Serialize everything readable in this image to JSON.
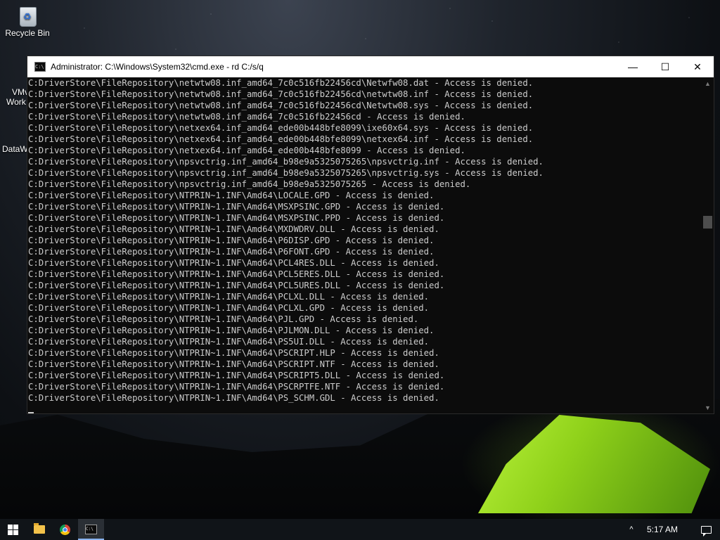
{
  "desktop": {
    "recycle_bin_label": "Recycle Bin",
    "partial_icon_1": "VMv",
    "partial_icon_1b": "Work",
    "partial_icon_2": "DataW"
  },
  "window": {
    "title": "Administrator: C:\\Windows\\System32\\cmd.exe - rd  C:/s/q",
    "minimize_glyph": "—",
    "maximize_glyph": "☐",
    "close_glyph": "✕"
  },
  "console": {
    "lines": [
      "C:DriverStore\\FileRepository\\netwtw08.inf_amd64_7c0c516fb22456cd\\Netwfw08.dat - Access is denied.",
      "C:DriverStore\\FileRepository\\netwtw08.inf_amd64_7c0c516fb22456cd\\netwtw08.inf - Access is denied.",
      "C:DriverStore\\FileRepository\\netwtw08.inf_amd64_7c0c516fb22456cd\\Netwtw08.sys - Access is denied.",
      "C:DriverStore\\FileRepository\\netwtw08.inf_amd64_7c0c516fb22456cd - Access is denied.",
      "C:DriverStore\\FileRepository\\netxex64.inf_amd64_ede00b448bfe8099\\ixe60x64.sys - Access is denied.",
      "C:DriverStore\\FileRepository\\netxex64.inf_amd64_ede00b448bfe8099\\netxex64.inf - Access is denied.",
      "C:DriverStore\\FileRepository\\netxex64.inf_amd64_ede00b448bfe8099 - Access is denied.",
      "C:DriverStore\\FileRepository\\npsvctrig.inf_amd64_b98e9a5325075265\\npsvctrig.inf - Access is denied.",
      "C:DriverStore\\FileRepository\\npsvctrig.inf_amd64_b98e9a5325075265\\npsvctrig.sys - Access is denied.",
      "C:DriverStore\\FileRepository\\npsvctrig.inf_amd64_b98e9a5325075265 - Access is denied.",
      "C:DriverStore\\FileRepository\\NTPRIN~1.INF\\Amd64\\LOCALE.GPD - Access is denied.",
      "C:DriverStore\\FileRepository\\NTPRIN~1.INF\\Amd64\\MSXPSINC.GPD - Access is denied.",
      "C:DriverStore\\FileRepository\\NTPRIN~1.INF\\Amd64\\MSXPSINC.PPD - Access is denied.",
      "C:DriverStore\\FileRepository\\NTPRIN~1.INF\\Amd64\\MXDWDRV.DLL - Access is denied.",
      "C:DriverStore\\FileRepository\\NTPRIN~1.INF\\Amd64\\P6DISP.GPD - Access is denied.",
      "C:DriverStore\\FileRepository\\NTPRIN~1.INF\\Amd64\\P6FONT.GPD - Access is denied.",
      "C:DriverStore\\FileRepository\\NTPRIN~1.INF\\Amd64\\PCL4RES.DLL - Access is denied.",
      "C:DriverStore\\FileRepository\\NTPRIN~1.INF\\Amd64\\PCL5ERES.DLL - Access is denied.",
      "C:DriverStore\\FileRepository\\NTPRIN~1.INF\\Amd64\\PCL5URES.DLL - Access is denied.",
      "C:DriverStore\\FileRepository\\NTPRIN~1.INF\\Amd64\\PCLXL.DLL - Access is denied.",
      "C:DriverStore\\FileRepository\\NTPRIN~1.INF\\Amd64\\PCLXL.GPD - Access is denied.",
      "C:DriverStore\\FileRepository\\NTPRIN~1.INF\\Amd64\\PJL.GPD - Access is denied.",
      "C:DriverStore\\FileRepository\\NTPRIN~1.INF\\Amd64\\PJLMON.DLL - Access is denied.",
      "C:DriverStore\\FileRepository\\NTPRIN~1.INF\\Amd64\\PS5UI.DLL - Access is denied.",
      "C:DriverStore\\FileRepository\\NTPRIN~1.INF\\Amd64\\PSCRIPT.HLP - Access is denied.",
      "C:DriverStore\\FileRepository\\NTPRIN~1.INF\\Amd64\\PSCRIPT.NTF - Access is denied.",
      "C:DriverStore\\FileRepository\\NTPRIN~1.INF\\Amd64\\PSCRIPT5.DLL - Access is denied.",
      "C:DriverStore\\FileRepository\\NTPRIN~1.INF\\Amd64\\PSCRPTFE.NTF - Access is denied.",
      "C:DriverStore\\FileRepository\\NTPRIN~1.INF\\Amd64\\PS_SCHM.GDL - Access is denied."
    ]
  },
  "taskbar": {
    "clock": "5:17 AM",
    "tray_chevron": "^",
    "cmd_icon_text": "C:\\"
  },
  "colors": {
    "console_bg": "#0c0c0c",
    "console_fg": "#cccccc",
    "taskbar_bg": "#101418",
    "tent_green": "#8fd11a"
  }
}
